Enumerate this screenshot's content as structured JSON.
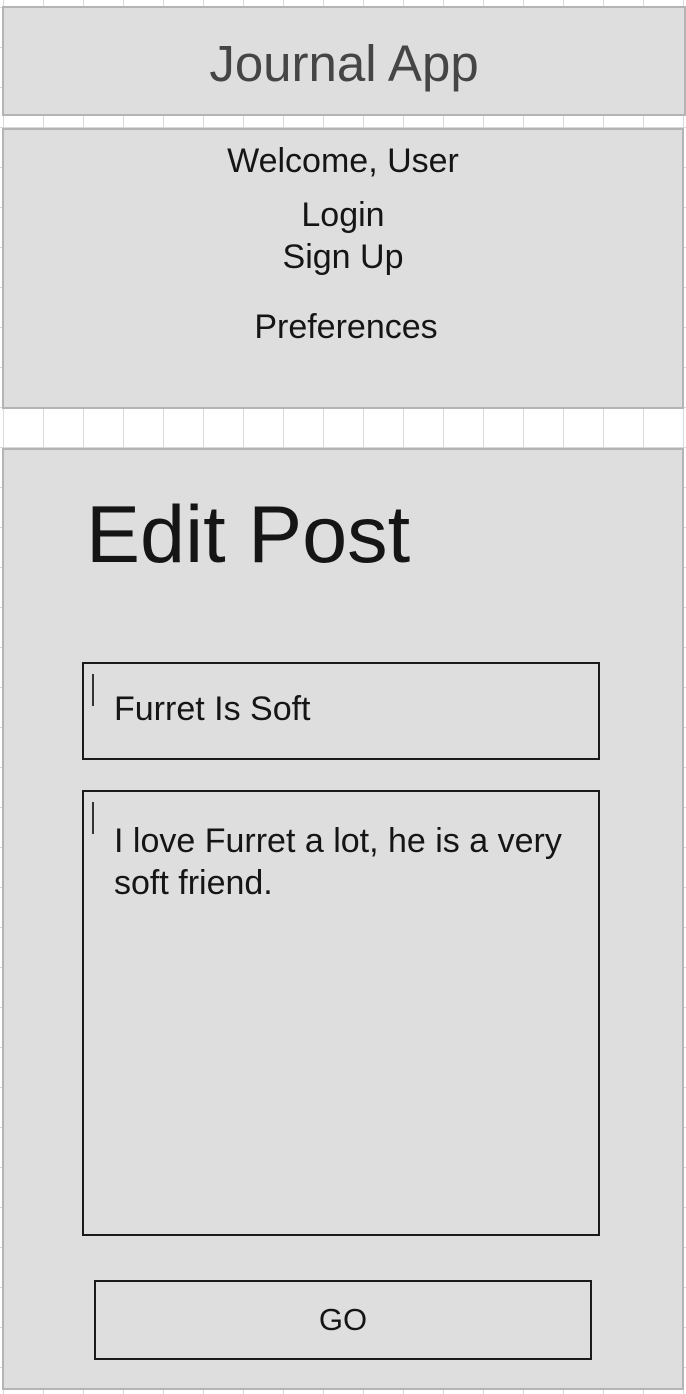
{
  "header": {
    "title": "Journal App"
  },
  "nav": {
    "welcome": "Welcome, User",
    "login": "Login",
    "signup": "Sign Up",
    "preferences": "Preferences"
  },
  "editor": {
    "heading": "Edit Post",
    "title_value": "Furret Is Soft",
    "body_value": "I love Furret a lot, he is a very soft friend.",
    "submit_label": "GO"
  }
}
